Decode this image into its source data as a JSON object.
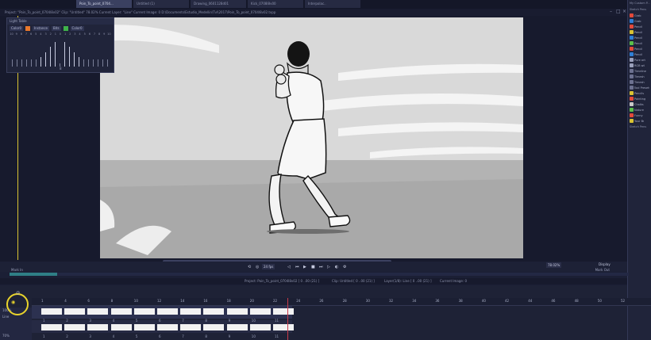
{
  "tabs": [
    {
      "label": "Poin_To_point_0704...",
      "active": true
    },
    {
      "label": "Untitled (1)",
      "active": false
    },
    {
      "label": "Drawing_0601128d01",
      "active": false
    },
    {
      "label": "Kick_0708l8v00",
      "active": false
    },
    {
      "label": "Interpolac..",
      "active": false
    }
  ],
  "project_bar": "Project: \"Poin_To_point_0704l8v02\"  Clip: \"Untitled\"  78.02%  Current Layer: \"Line\"  Current Image: 0 D:\\Documents\\Estudio_Medellin\\Tvl\\2017\\Poin_To_point_0704l8v02.tvpp",
  "light_table": {
    "title": "Light Table",
    "color_before_label": "Color0",
    "instance_label": "Instance",
    "color_after_label": "Color0",
    "mid_label": "Bits",
    "numbers": [
      "10",
      "9",
      "8",
      "7",
      "6",
      "5",
      "4",
      "3",
      "2",
      "1",
      "0",
      "1",
      "2",
      "3",
      "4",
      "5",
      "6",
      "7",
      "8",
      "9",
      "10"
    ],
    "bar_levels": [
      0.15,
      0.15,
      0.15,
      0.15,
      0.15,
      0.15,
      0.25,
      0.45,
      0.65,
      0.85,
      0,
      0.85,
      0.65,
      0.45,
      0.25,
      0.15,
      0.15,
      0.15,
      0.15,
      0.15,
      0.15
    ],
    "bottom_value": "8"
  },
  "right_panel": {
    "header": "My Custom P...",
    "brushes_title": "Sketch Pens",
    "items": [
      {
        "label": "Grab",
        "color": "#e24a3b"
      },
      {
        "label": "Grab",
        "color": "#2f7fd6"
      },
      {
        "label": "Pencil",
        "color": "#e24a3b"
      },
      {
        "label": "Pencil",
        "color": "#d9c332"
      },
      {
        "label": "Pencil",
        "color": "#2f7fd6"
      },
      {
        "label": "Pencil",
        "color": "#5bbf4a"
      },
      {
        "label": "Pencil",
        "color": "#e24a3b"
      },
      {
        "label": "Pencil",
        "color": "#2f7fd6"
      },
      {
        "label": "Pure art",
        "color": "#9aa0bb"
      },
      {
        "label": "RGB wil",
        "color": "#9aa0bb"
      },
      {
        "label": "Timeline",
        "color": "#6c7190"
      },
      {
        "label": "Timesh",
        "color": "#6c7190"
      },
      {
        "label": "Timesh",
        "color": "#6c7190"
      },
      {
        "label": "Tool Presets",
        "color": "#6c7190"
      },
      {
        "label": "Pencils",
        "color": "#d9c332"
      },
      {
        "label": "Painting",
        "color": "#e24a3b"
      },
      {
        "label": "Chalks",
        "color": "#c9c9c9"
      },
      {
        "label": "Nature",
        "color": "#5bbf4a"
      },
      {
        "label": "Funny",
        "color": "#e24a3b"
      },
      {
        "label": "Your Br",
        "color": "#d9c332"
      }
    ],
    "footer": "Sketch Pens"
  },
  "transport": {
    "fps": "24 fps",
    "zoom": "78.02%",
    "display_label": "Display",
    "mark_in_label": "Mark In",
    "mark_out_label": "Mark Out",
    "mark_out_value": "21"
  },
  "info_bar": {
    "project": "Project: Poin_To_point_0704l8v02 [ 0 ..00 (21) ]",
    "clip": "Clip: Untitled [ 0 ..00 (21) ]",
    "layer": "Layer(1/8): Line [ 0 ..00 (21) ]",
    "image": "Current Image: 0"
  },
  "timeline": {
    "ruler_ticks": [
      "1",
      "4",
      "6",
      "8",
      "10",
      "12",
      "14",
      "16",
      "18",
      "20",
      "22",
      "24",
      "26",
      "28",
      "30",
      "32",
      "34",
      "36",
      "38",
      "40",
      "42",
      "44",
      "46",
      "48",
      "50",
      "52"
    ],
    "track_numbers_row1": [
      "1",
      "2",
      "3",
      "4",
      "5",
      "6",
      "7",
      "8",
      "9",
      "10",
      "11"
    ],
    "track_numbers_row2": [
      "1",
      "2",
      "3",
      "4",
      "5",
      "6",
      "7",
      "8",
      "9",
      "10",
      "11"
    ],
    "left_labels": [
      "100%",
      "Line",
      "70%"
    ]
  }
}
